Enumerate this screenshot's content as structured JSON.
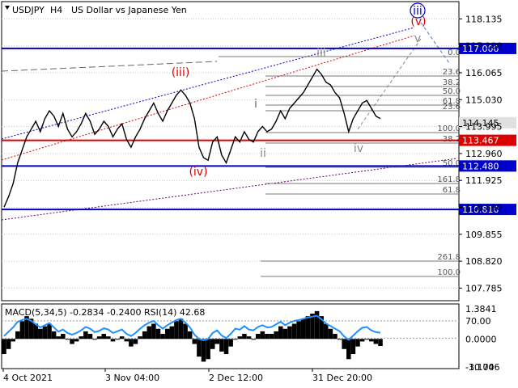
{
  "chart_data": {
    "type": "line",
    "header": {
      "symbol": "USDJPY",
      "timeframe": "H4",
      "description": "US Dollar vs Japanese Yen"
    },
    "y_axis": {
      "range": [
        107.3,
        118.8
      ],
      "ticks": [
        "118.135",
        "117.100",
        "116.065",
        "115.030",
        "113.995",
        "112.960",
        "111.925",
        "110.890",
        "109.855",
        "108.820",
        "107.785"
      ]
    },
    "x_axis": {
      "ticks": [
        "4 Oct 2021",
        "3 Nov 04:00",
        "2 Dec 12:00",
        "31 Dec 20:00"
      ]
    },
    "price_series": {
      "name": "USDJPY close (approx.)",
      "values": [
        110.9,
        111.3,
        111.8,
        112.6,
        113.1,
        113.6,
        113.9,
        114.2,
        113.8,
        114.3,
        114.6,
        114.4,
        114.0,
        114.5,
        113.9,
        113.6,
        113.8,
        114.1,
        114.5,
        114.2,
        113.7,
        113.9,
        114.2,
        114.0,
        113.6,
        113.9,
        114.1,
        113.5,
        113.2,
        113.6,
        113.9,
        114.3,
        114.6,
        114.9,
        114.5,
        114.2,
        114.6,
        114.9,
        115.2,
        115.4,
        115.2,
        114.9,
        114.3,
        113.2,
        112.8,
        112.7,
        113.4,
        113.6,
        112.9,
        112.6,
        113.1,
        113.6,
        113.4,
        113.8,
        113.5,
        113.4,
        113.8,
        114.0,
        113.8,
        113.9,
        114.2,
        114.6,
        114.3,
        114.7,
        114.9,
        115.1,
        115.3,
        115.6,
        115.9,
        116.2,
        116.0,
        115.7,
        115.6,
        115.3,
        115.1,
        114.5,
        113.8,
        114.3,
        114.6,
        114.9,
        115.0,
        114.7,
        114.4,
        114.3
      ]
    },
    "levels": [
      {
        "label": "117.000",
        "value": 117.0,
        "color": "#0000cc"
      },
      {
        "label": "113.467",
        "value": 113.467,
        "color": "#dd0000"
      },
      {
        "label": "112.480",
        "value": 112.48,
        "color": "#0000cc"
      },
      {
        "label": "110.810",
        "value": 110.81,
        "color": "#0000cc"
      }
    ],
    "current_price": {
      "label": "114.145",
      "value": 114.145
    },
    "fib_labels": [
      "0.0",
      "23.6",
      "38.2",
      "50.0",
      "61.8",
      "23.6",
      "100.0",
      "38.2",
      "50.0",
      "161.8",
      "61.8",
      "261.8",
      "100.0"
    ],
    "wave_labels": [
      {
        "text": "(iii)",
        "color": "#dd0000"
      },
      {
        "text": "(iv)",
        "color": "#dd0000"
      },
      {
        "text": "(v)",
        "color": "#dd0000"
      },
      {
        "text": "iii",
        "color": "#0000cc"
      },
      {
        "text": "iii",
        "color": "#888888"
      },
      {
        "text": "i",
        "color": "#666666"
      },
      {
        "text": "ii",
        "color": "#888888"
      },
      {
        "text": "iv",
        "color": "#888888"
      },
      {
        "text": "v",
        "color": "#888888"
      }
    ],
    "indicator": {
      "label": "MACD(5,34,5) -0.2834 -0.2400 RSI(14) 42.68",
      "y_ticks": [
        "1.3841",
        "70.00",
        "0.0000",
        "-30.00",
        "-1.1746"
      ],
      "macd_values": [
        -0.6,
        -0.4,
        -0.1,
        0.3,
        0.7,
        0.9,
        0.8,
        0.6,
        0.4,
        0.5,
        0.6,
        0.3,
        0.1,
        0.2,
        0.0,
        -0.2,
        -0.1,
        0.1,
        0.3,
        0.2,
        0.0,
        0.1,
        0.2,
        0.1,
        -0.1,
        0.0,
        0.1,
        -0.1,
        -0.3,
        -0.2,
        0.1,
        0.3,
        0.5,
        0.6,
        0.4,
        0.2,
        0.4,
        0.5,
        0.7,
        0.8,
        0.6,
        0.3,
        -0.2,
        -0.7,
        -0.9,
        -0.8,
        -0.4,
        -0.2,
        -0.5,
        -0.6,
        -0.3,
        0.0,
        0.1,
        0.2,
        0.1,
        0.0,
        0.2,
        0.3,
        0.2,
        0.2,
        0.3,
        0.5,
        0.4,
        0.5,
        0.6,
        0.7,
        0.8,
        0.9,
        1.0,
        1.1,
        0.9,
        0.6,
        0.4,
        0.2,
        0.0,
        -0.4,
        -0.8,
        -0.6,
        -0.3,
        -0.1,
        0.0,
        -0.1,
        -0.2,
        -0.28
      ],
      "rsi_values": [
        35,
        45,
        55,
        68,
        72,
        75,
        70,
        62,
        55,
        60,
        65,
        55,
        45,
        50,
        42,
        38,
        42,
        48,
        56,
        52,
        44,
        47,
        53,
        50,
        42,
        46,
        50,
        40,
        35,
        42,
        52,
        60,
        66,
        70,
        60,
        52,
        60,
        66,
        72,
        75,
        66,
        55,
        38,
        28,
        25,
        28,
        42,
        48,
        36,
        30,
        40,
        52,
        50,
        58,
        50,
        48,
        56,
        60,
        55,
        56,
        62,
        68,
        60,
        66,
        70,
        72,
        75,
        78,
        80,
        82,
        74,
        64,
        58,
        52,
        46,
        34,
        26,
        36,
        46,
        54,
        56,
        48,
        44,
        42.68
      ],
      "rsi_levels": [
        70,
        30
      ]
    }
  }
}
